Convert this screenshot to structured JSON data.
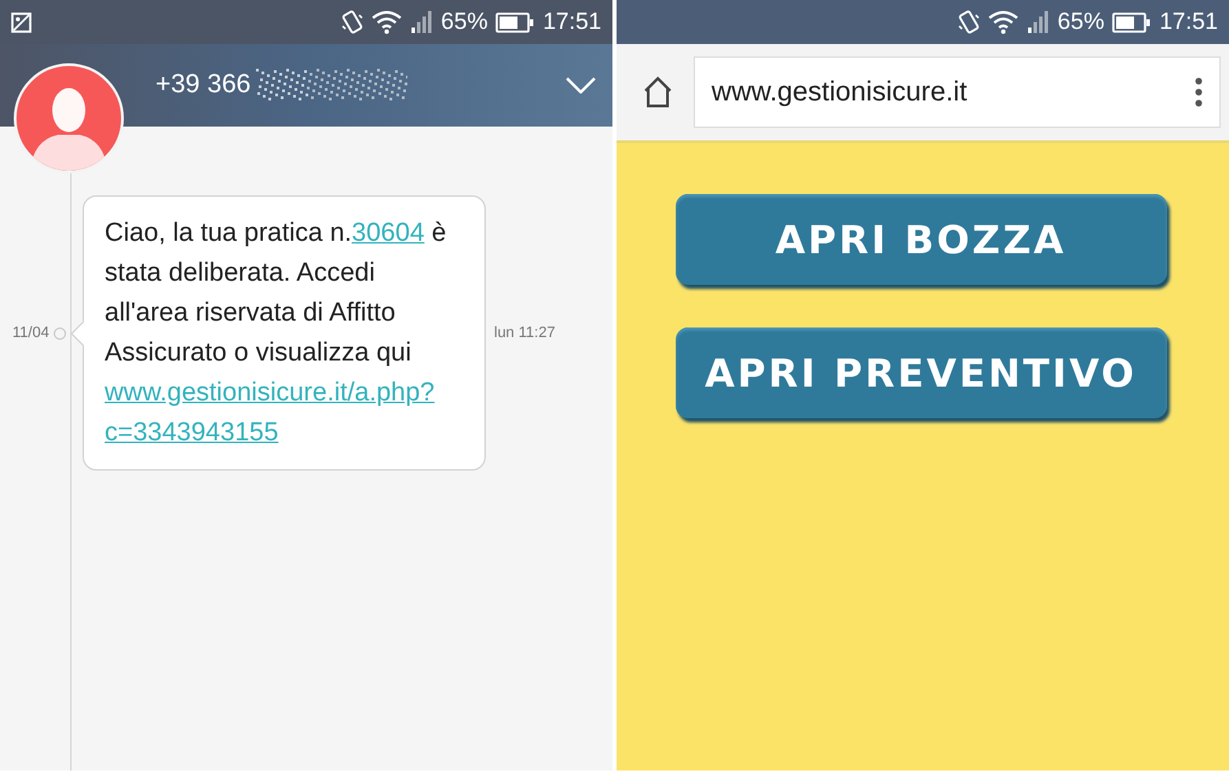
{
  "sms_screen": {
    "status_bar": {
      "battery": "65%",
      "time": "17:51"
    },
    "contact": {
      "number": "+39 366"
    },
    "message": {
      "date": "11/04",
      "time": "lun 11:27",
      "parts": [
        {
          "kind": "text",
          "text": "Ciao, la tua pratica n."
        },
        {
          "kind": "link",
          "text": "30604"
        },
        {
          "kind": "text",
          "text": " è stata deliberata. Accedi all'area riservata di Affitto Assicurato o visualizza qui "
        },
        {
          "kind": "link",
          "text": "www.gestionisicure.it/a.php?"
        },
        {
          "kind": "link",
          "text": "c=3343943155"
        }
      ]
    }
  },
  "browser_screen": {
    "status_bar": {
      "battery": "65%",
      "time": "17:51"
    },
    "address_bar": {
      "url": "www.gestionisicure.it"
    },
    "buttons": [
      "APRI BOZZA",
      "APRI PREVENTIVO"
    ]
  }
}
